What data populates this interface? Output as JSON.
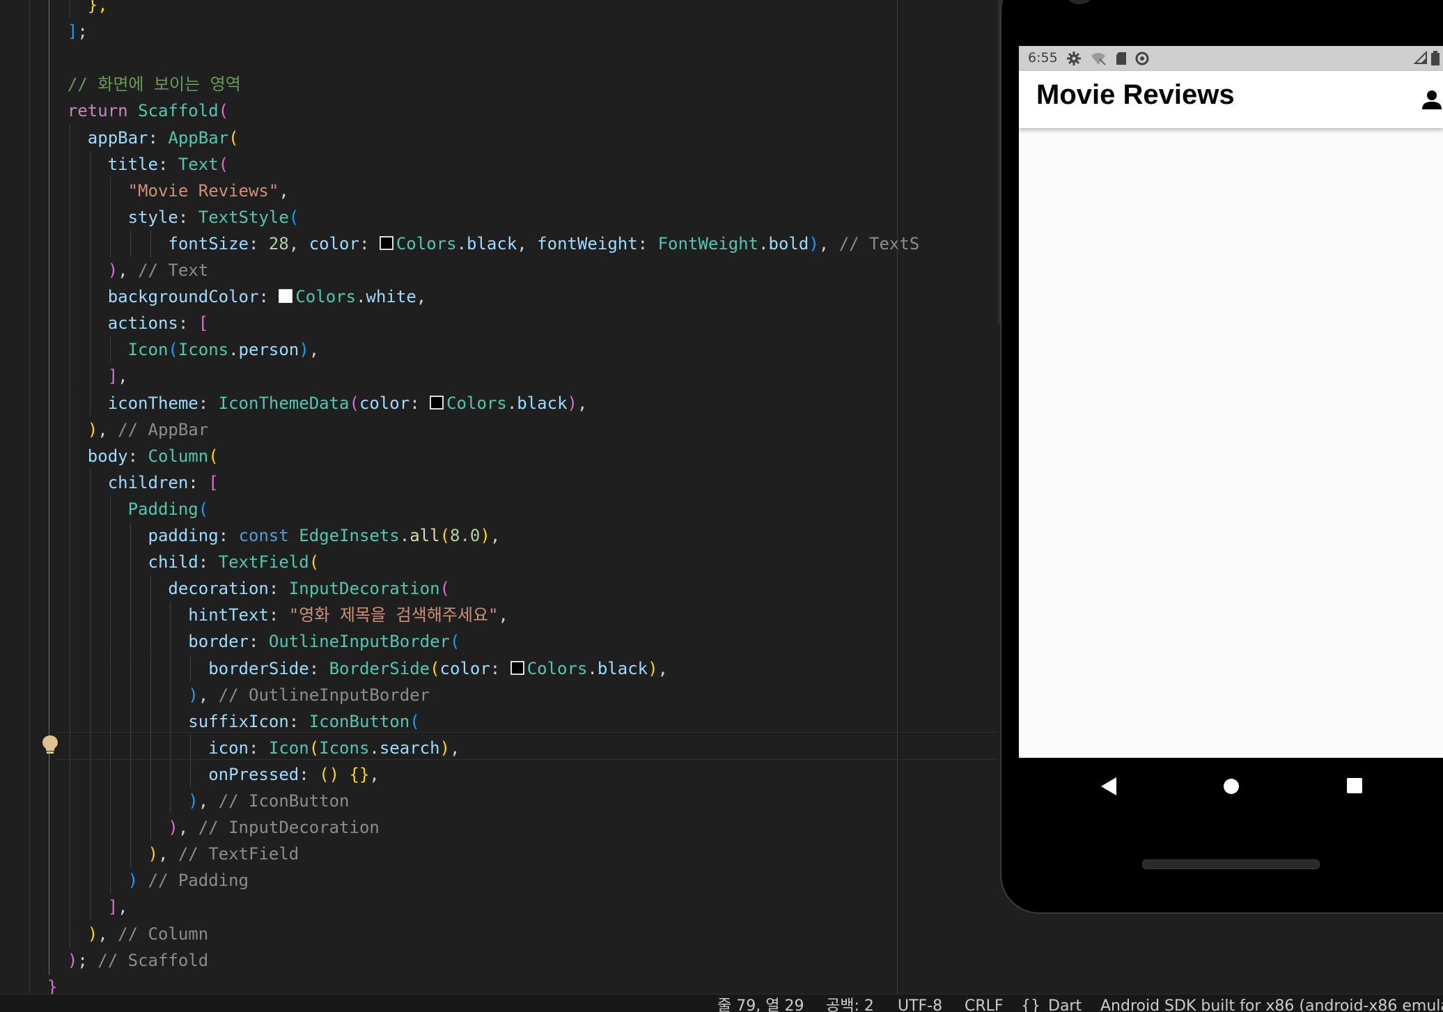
{
  "editor": {
    "lines": [
      [
        {
          "t": "    ",
          "c": "#d4d4d4"
        },
        {
          "t": "},",
          "c": "#ffd700"
        }
      ],
      [
        {
          "t": "  ",
          "c": "#d4d4d4"
        },
        {
          "t": "]",
          "c": "#179fff"
        },
        {
          "t": ";",
          "c": "#d4d4d4"
        }
      ],
      [],
      [
        {
          "t": "  ",
          "c": "#d4d4d4"
        },
        {
          "t": "// 화면에 보이는 영역",
          "c": "#6a9955"
        }
      ],
      [
        {
          "t": "  ",
          "c": "#d4d4d4"
        },
        {
          "t": "return",
          "c": "#c586c0"
        },
        {
          "t": " ",
          "c": "#d4d4d4"
        },
        {
          "t": "Scaffold",
          "c": "#4ec9b0"
        },
        {
          "t": "(",
          "c": "#da70d6"
        }
      ],
      [
        {
          "t": "    ",
          "c": "#d4d4d4"
        },
        {
          "t": "appBar",
          "c": "#9cdcfe"
        },
        {
          "t": ": ",
          "c": "#d4d4d4"
        },
        {
          "t": "AppBar",
          "c": "#4ec9b0"
        },
        {
          "t": "(",
          "c": "#ffd700"
        }
      ],
      [
        {
          "t": "      ",
          "c": "#d4d4d4"
        },
        {
          "t": "title",
          "c": "#9cdcfe"
        },
        {
          "t": ": ",
          "c": "#d4d4d4"
        },
        {
          "t": "Text",
          "c": "#4ec9b0"
        },
        {
          "t": "(",
          "c": "#da70d6"
        }
      ],
      [
        {
          "t": "        ",
          "c": "#d4d4d4"
        },
        {
          "t": "\"Movie Reviews\"",
          "c": "#ce9178"
        },
        {
          "t": ",",
          "c": "#d4d4d4"
        }
      ],
      [
        {
          "t": "        ",
          "c": "#d4d4d4"
        },
        {
          "t": "style",
          "c": "#9cdcfe"
        },
        {
          "t": ": ",
          "c": "#d4d4d4"
        },
        {
          "t": "TextStyle",
          "c": "#4ec9b0"
        },
        {
          "t": "(",
          "c": "#179fff"
        }
      ],
      [
        {
          "t": "            ",
          "c": "#d4d4d4"
        },
        {
          "t": "fontSize",
          "c": "#9cdcfe"
        },
        {
          "t": ": ",
          "c": "#d4d4d4"
        },
        {
          "t": "28",
          "c": "#b5cea8"
        },
        {
          "t": ", ",
          "c": "#d4d4d4"
        },
        {
          "t": "color",
          "c": "#9cdcfe"
        },
        {
          "t": ": ",
          "c": "#d4d4d4"
        },
        {
          "sw": "black"
        },
        {
          "t": "Colors",
          "c": "#4ec9b0"
        },
        {
          "t": ".",
          "c": "#d4d4d4"
        },
        {
          "t": "black",
          "c": "#9cdcfe"
        },
        {
          "t": ", ",
          "c": "#d4d4d4"
        },
        {
          "t": "fontWeight",
          "c": "#9cdcfe"
        },
        {
          "t": ": ",
          "c": "#d4d4d4"
        },
        {
          "t": "FontWeight",
          "c": "#4ec9b0"
        },
        {
          "t": ".",
          "c": "#d4d4d4"
        },
        {
          "t": "bold",
          "c": "#9cdcfe"
        },
        {
          "t": ")",
          "c": "#179fff"
        },
        {
          "t": ", ",
          "c": "#d4d4d4"
        },
        {
          "t": "// TextS",
          "c": "#8c8c8c"
        }
      ],
      [
        {
          "t": "      ",
          "c": "#d4d4d4"
        },
        {
          "t": ")",
          "c": "#da70d6"
        },
        {
          "t": ", ",
          "c": "#d4d4d4"
        },
        {
          "t": "// Text",
          "c": "#8c8c8c"
        }
      ],
      [
        {
          "t": "      ",
          "c": "#d4d4d4"
        },
        {
          "t": "backgroundColor",
          "c": "#9cdcfe"
        },
        {
          "t": ": ",
          "c": "#d4d4d4"
        },
        {
          "sw": "white"
        },
        {
          "t": "Colors",
          "c": "#4ec9b0"
        },
        {
          "t": ".",
          "c": "#d4d4d4"
        },
        {
          "t": "white",
          "c": "#9cdcfe"
        },
        {
          "t": ",",
          "c": "#d4d4d4"
        }
      ],
      [
        {
          "t": "      ",
          "c": "#d4d4d4"
        },
        {
          "t": "actions",
          "c": "#9cdcfe"
        },
        {
          "t": ": ",
          "c": "#d4d4d4"
        },
        {
          "t": "[",
          "c": "#da70d6"
        }
      ],
      [
        {
          "t": "        ",
          "c": "#d4d4d4"
        },
        {
          "t": "Icon",
          "c": "#4ec9b0"
        },
        {
          "t": "(",
          "c": "#179fff"
        },
        {
          "t": "Icons",
          "c": "#4ec9b0"
        },
        {
          "t": ".",
          "c": "#d4d4d4"
        },
        {
          "t": "person",
          "c": "#9cdcfe"
        },
        {
          "t": ")",
          "c": "#179fff"
        },
        {
          "t": ",",
          "c": "#d4d4d4"
        }
      ],
      [
        {
          "t": "      ",
          "c": "#d4d4d4"
        },
        {
          "t": "]",
          "c": "#da70d6"
        },
        {
          "t": ",",
          "c": "#d4d4d4"
        }
      ],
      [
        {
          "t": "      ",
          "c": "#d4d4d4"
        },
        {
          "t": "iconTheme",
          "c": "#9cdcfe"
        },
        {
          "t": ": ",
          "c": "#d4d4d4"
        },
        {
          "t": "IconThemeData",
          "c": "#4ec9b0"
        },
        {
          "t": "(",
          "c": "#da70d6"
        },
        {
          "t": "color",
          "c": "#9cdcfe"
        },
        {
          "t": ": ",
          "c": "#d4d4d4"
        },
        {
          "sw": "black"
        },
        {
          "t": "Colors",
          "c": "#4ec9b0"
        },
        {
          "t": ".",
          "c": "#d4d4d4"
        },
        {
          "t": "black",
          "c": "#9cdcfe"
        },
        {
          "t": ")",
          "c": "#da70d6"
        },
        {
          "t": ",",
          "c": "#d4d4d4"
        }
      ],
      [
        {
          "t": "    ",
          "c": "#d4d4d4"
        },
        {
          "t": ")",
          "c": "#ffd700"
        },
        {
          "t": ", ",
          "c": "#d4d4d4"
        },
        {
          "t": "// AppBar",
          "c": "#8c8c8c"
        }
      ],
      [
        {
          "t": "    ",
          "c": "#d4d4d4"
        },
        {
          "t": "body",
          "c": "#9cdcfe"
        },
        {
          "t": ": ",
          "c": "#d4d4d4"
        },
        {
          "t": "Column",
          "c": "#4ec9b0"
        },
        {
          "t": "(",
          "c": "#ffd700"
        }
      ],
      [
        {
          "t": "      ",
          "c": "#d4d4d4"
        },
        {
          "t": "children",
          "c": "#9cdcfe"
        },
        {
          "t": ": ",
          "c": "#d4d4d4"
        },
        {
          "t": "[",
          "c": "#da70d6"
        }
      ],
      [
        {
          "t": "        ",
          "c": "#d4d4d4"
        },
        {
          "t": "Padding",
          "c": "#4ec9b0"
        },
        {
          "t": "(",
          "c": "#179fff"
        }
      ],
      [
        {
          "t": "          ",
          "c": "#d4d4d4"
        },
        {
          "t": "padding",
          "c": "#9cdcfe"
        },
        {
          "t": ": ",
          "c": "#d4d4d4"
        },
        {
          "t": "const",
          "c": "#569cd6"
        },
        {
          "t": " ",
          "c": "#d4d4d4"
        },
        {
          "t": "EdgeInsets",
          "c": "#4ec9b0"
        },
        {
          "t": ".",
          "c": "#d4d4d4"
        },
        {
          "t": "all",
          "c": "#dcdcaa"
        },
        {
          "t": "(",
          "c": "#ffd700"
        },
        {
          "t": "8.0",
          "c": "#b5cea8"
        },
        {
          "t": ")",
          "c": "#ffd700"
        },
        {
          "t": ",",
          "c": "#d4d4d4"
        }
      ],
      [
        {
          "t": "          ",
          "c": "#d4d4d4"
        },
        {
          "t": "child",
          "c": "#9cdcfe"
        },
        {
          "t": ": ",
          "c": "#d4d4d4"
        },
        {
          "t": "TextField",
          "c": "#4ec9b0"
        },
        {
          "t": "(",
          "c": "#ffd700"
        }
      ],
      [
        {
          "t": "            ",
          "c": "#d4d4d4"
        },
        {
          "t": "decoration",
          "c": "#9cdcfe"
        },
        {
          "t": ": ",
          "c": "#d4d4d4"
        },
        {
          "t": "InputDecoration",
          "c": "#4ec9b0"
        },
        {
          "t": "(",
          "c": "#da70d6"
        }
      ],
      [
        {
          "t": "              ",
          "c": "#d4d4d4"
        },
        {
          "t": "hintText",
          "c": "#9cdcfe"
        },
        {
          "t": ": ",
          "c": "#d4d4d4"
        },
        {
          "t": "\"영화 제목을 검색해주세요\"",
          "c": "#ce9178"
        },
        {
          "t": ",",
          "c": "#d4d4d4"
        }
      ],
      [
        {
          "t": "              ",
          "c": "#d4d4d4"
        },
        {
          "t": "border",
          "c": "#9cdcfe"
        },
        {
          "t": ": ",
          "c": "#d4d4d4"
        },
        {
          "t": "OutlineInputBorder",
          "c": "#4ec9b0"
        },
        {
          "t": "(",
          "c": "#179fff"
        }
      ],
      [
        {
          "t": "                ",
          "c": "#d4d4d4"
        },
        {
          "t": "borderSide",
          "c": "#9cdcfe"
        },
        {
          "t": ": ",
          "c": "#d4d4d4"
        },
        {
          "t": "BorderSide",
          "c": "#4ec9b0"
        },
        {
          "t": "(",
          "c": "#ffd700"
        },
        {
          "t": "color",
          "c": "#9cdcfe"
        },
        {
          "t": ": ",
          "c": "#d4d4d4"
        },
        {
          "sw": "black"
        },
        {
          "t": "Colors",
          "c": "#4ec9b0"
        },
        {
          "t": ".",
          "c": "#d4d4d4"
        },
        {
          "t": "black",
          "c": "#9cdcfe"
        },
        {
          "t": ")",
          "c": "#ffd700"
        },
        {
          "t": ",",
          "c": "#d4d4d4"
        }
      ],
      [
        {
          "t": "              ",
          "c": "#d4d4d4"
        },
        {
          "t": ")",
          "c": "#179fff"
        },
        {
          "t": ", ",
          "c": "#d4d4d4"
        },
        {
          "t": "// OutlineInputBorder",
          "c": "#8c8c8c"
        }
      ],
      [
        {
          "t": "              ",
          "c": "#d4d4d4"
        },
        {
          "t": "suffixIcon",
          "c": "#9cdcfe"
        },
        {
          "t": ": ",
          "c": "#d4d4d4"
        },
        {
          "t": "IconButton",
          "c": "#4ec9b0"
        },
        {
          "t": "(",
          "c": "#179fff"
        }
      ],
      [
        {
          "t": "                ",
          "c": "#d4d4d4"
        },
        {
          "t": "icon",
          "c": "#9cdcfe"
        },
        {
          "t": ": ",
          "c": "#d4d4d4"
        },
        {
          "t": "Icon",
          "c": "#4ec9b0"
        },
        {
          "t": "(",
          "c": "#ffd700"
        },
        {
          "t": "Icons",
          "c": "#4ec9b0"
        },
        {
          "t": ".",
          "c": "#d4d4d4"
        },
        {
          "t": "search",
          "c": "#9cdcfe"
        },
        {
          "t": ")",
          "c": "#ffd700"
        },
        {
          "t": ",",
          "c": "#d4d4d4"
        }
      ],
      [
        {
          "t": "                ",
          "c": "#d4d4d4"
        },
        {
          "t": "onPressed",
          "c": "#9cdcfe"
        },
        {
          "t": ": ",
          "c": "#d4d4d4"
        },
        {
          "t": "()",
          "c": "#ffd700"
        },
        {
          "t": " ",
          "c": "#d4d4d4"
        },
        {
          "t": "{}",
          "c": "#ffd700"
        },
        {
          "t": ",",
          "c": "#d4d4d4"
        }
      ],
      [
        {
          "t": "              ",
          "c": "#d4d4d4"
        },
        {
          "t": ")",
          "c": "#179fff"
        },
        {
          "t": ", ",
          "c": "#d4d4d4"
        },
        {
          "t": "// IconButton",
          "c": "#8c8c8c"
        }
      ],
      [
        {
          "t": "            ",
          "c": "#d4d4d4"
        },
        {
          "t": ")",
          "c": "#da70d6"
        },
        {
          "t": ", ",
          "c": "#d4d4d4"
        },
        {
          "t": "// InputDecoration",
          "c": "#8c8c8c"
        }
      ],
      [
        {
          "t": "          ",
          "c": "#d4d4d4"
        },
        {
          "t": ")",
          "c": "#ffd700"
        },
        {
          "t": ", ",
          "c": "#d4d4d4"
        },
        {
          "t": "// TextField",
          "c": "#8c8c8c"
        }
      ],
      [
        {
          "t": "        ",
          "c": "#d4d4d4"
        },
        {
          "t": ")",
          "c": "#179fff"
        },
        {
          "t": " ",
          "c": "#d4d4d4"
        },
        {
          "t": "// Padding",
          "c": "#8c8c8c"
        }
      ],
      [
        {
          "t": "      ",
          "c": "#d4d4d4"
        },
        {
          "t": "]",
          "c": "#da70d6"
        },
        {
          "t": ",",
          "c": "#d4d4d4"
        }
      ],
      [
        {
          "t": "    ",
          "c": "#d4d4d4"
        },
        {
          "t": ")",
          "c": "#ffd700"
        },
        {
          "t": ", ",
          "c": "#d4d4d4"
        },
        {
          "t": "// Column",
          "c": "#8c8c8c"
        }
      ],
      [
        {
          "t": "  ",
          "c": "#d4d4d4"
        },
        {
          "t": ")",
          "c": "#da70d6"
        },
        {
          "t": "; ",
          "c": "#d4d4d4"
        },
        {
          "t": "// Scaffold",
          "c": "#8c8c8c"
        }
      ],
      [
        {
          "t": "}",
          "c": "#da70d6"
        }
      ]
    ],
    "lightbulb_icon": "lightbulb-icon"
  },
  "phone": {
    "status_time": "6:55",
    "status_icons": [
      "gear-icon",
      "wifi-off-icon",
      "sd-card-icon",
      "sync-circle-icon",
      "signal-icon",
      "battery-icon"
    ],
    "app_title": "Movie Reviews",
    "action_icon": "person-icon",
    "nav_icons": [
      "back-triangle-icon",
      "home-circle-icon",
      "recents-square-icon"
    ]
  },
  "status_bar": {
    "cursor": "줄 79, 열 29",
    "indent": "공백: 2",
    "encoding": "UTF-8",
    "eol": "CRLF",
    "language_icon": "{}",
    "language": "Dart",
    "device": "Android SDK built for x86 (android-x86 emulat"
  },
  "colors": {
    "editor_bg": "#1f1f1f",
    "keyword": "#c586c0",
    "type": "#4ec9b0",
    "property": "#9cdcfe",
    "string": "#ce9178",
    "comment": "#6a9955",
    "bracket_gold": "#ffd700",
    "bracket_violet": "#da70d6",
    "bracket_blue": "#179fff"
  }
}
